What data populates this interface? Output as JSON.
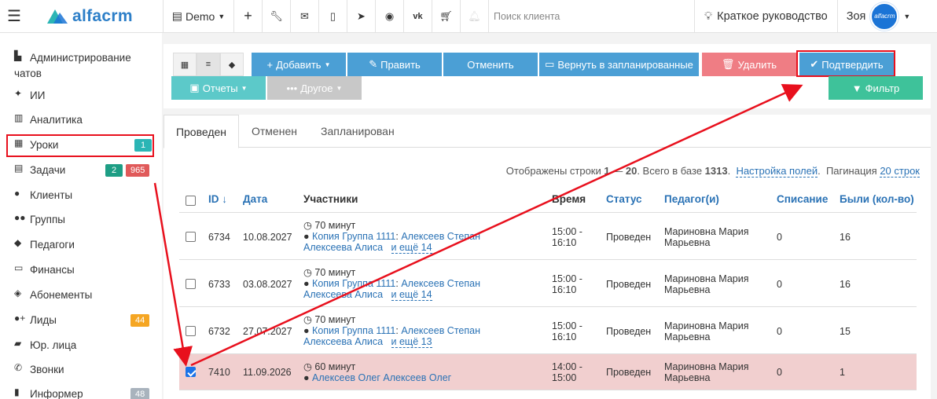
{
  "app": {
    "logo_text": "alfacrm",
    "company": "Demo",
    "search_placeholder": "Поиск клиента",
    "guide_label": "Краткое руководство",
    "user_name": "Зоя",
    "avatar_text": "alfacrm"
  },
  "sidebar": {
    "items": [
      {
        "label": "Администрирование",
        "label2": "чатов",
        "icon": "chat-settings-icon"
      },
      {
        "label": "ИИ",
        "icon": "sparkle-icon"
      },
      {
        "label": "Аналитика",
        "icon": "map-icon"
      },
      {
        "label": "Уроки",
        "icon": "calendar-icon",
        "badge": "1",
        "badge_color": "#2bb5b5"
      },
      {
        "label": "Задачи",
        "icon": "clipboard-icon",
        "badge": "2",
        "badge_color": "#1e9e85",
        "badge2": "965",
        "badge2_color": "#e05a5a"
      },
      {
        "label": "Клиенты",
        "icon": "user-icon"
      },
      {
        "label": "Группы",
        "icon": "users-icon"
      },
      {
        "label": "Педагоги",
        "icon": "graduation-cap-icon"
      },
      {
        "label": "Финансы",
        "icon": "money-icon"
      },
      {
        "label": "Абонементы",
        "icon": "tag-icon"
      },
      {
        "label": "Лиды",
        "icon": "user-plus-icon",
        "badge": "44",
        "badge_color": "#f5a623"
      },
      {
        "label": "Юр. лица",
        "icon": "briefcase-icon"
      },
      {
        "label": "Звонки",
        "icon": "phone-icon"
      },
      {
        "label": "Информер",
        "icon": "book-icon",
        "badge": "48",
        "badge_color": "#a9b3bd"
      }
    ]
  },
  "toolbar": {
    "add": "Добавить",
    "edit": "Править",
    "cancel": "Отменить",
    "return_planned": "Вернуть в запланированные",
    "delete": "Удалить",
    "confirm": "Подтвердить",
    "reports": "Отчеты",
    "other": "Другое",
    "filter": "Фильтр"
  },
  "tabs": [
    "Проведен",
    "Отменен",
    "Запланирован"
  ],
  "info": {
    "shown_prefix": "Отображены строки",
    "range_start": "1",
    "range_sep": " — ",
    "range_end": "20",
    "total_prefix": ". Всего в базе",
    "total": "1313",
    "fields_link": "Настройка полей",
    "pagination_label": "Пагинация",
    "pagination_value": "20 строк"
  },
  "table": {
    "headers": {
      "id": "ID ↓",
      "date": "Дата",
      "participants": "Участники",
      "time": "Время",
      "status": "Статус",
      "teacher": "Педагог(и)",
      "writeoff": "Списание",
      "attended": "Были (кол-во)"
    },
    "rows": [
      {
        "id": "6734",
        "date": "10.08.2027",
        "duration": "70 минут",
        "group": "Копия Группа 1111",
        "participant": "Алексеев Степан",
        "participant2": "Алексеева Алиса",
        "more": "и ещё 14",
        "time1": "15:00 -",
        "time2": "16:10",
        "status": "Проведен",
        "teacher1": "Мариновна Мария",
        "teacher2": "Марьевна",
        "writeoff": "0",
        "attended": "16",
        "checked": false
      },
      {
        "id": "6733",
        "date": "03.08.2027",
        "duration": "70 минут",
        "group": "Копия Группа 1111",
        "participant": "Алексеев Степан",
        "participant2": "Алексеева Алиса",
        "more": "и ещё 14",
        "time1": "15:00 -",
        "time2": "16:10",
        "status": "Проведен",
        "teacher1": "Мариновна Мария",
        "teacher2": "Марьевна",
        "writeoff": "0",
        "attended": "16",
        "checked": false
      },
      {
        "id": "6732",
        "date": "27.07.2027",
        "duration": "70 минут",
        "group": "Копия Группа 1111",
        "participant": "Алексеев Степан",
        "participant2": "Алексеева Алиса",
        "more": "и ещё 13",
        "time1": "15:00 -",
        "time2": "16:10",
        "status": "Проведен",
        "teacher1": "Мариновна Мария",
        "teacher2": "Марьевна",
        "writeoff": "0",
        "attended": "15",
        "checked": false
      },
      {
        "id": "7410",
        "date": "11.09.2026",
        "duration": "60 минут",
        "participant": "Алексеев Олег Алексеев Олег",
        "time1": "14:00 -",
        "time2": "15:00",
        "status": "Проведен",
        "teacher1": "Мариновна Мария",
        "teacher2": "Марьевна",
        "writeoff": "0",
        "attended": "1",
        "checked": true
      }
    ]
  },
  "colors": {
    "primary_blue": "#4b9fd5",
    "danger_red": "#ef7d84",
    "teal": "#5cc9c9",
    "green": "#3ec29a",
    "grey": "#c8c8c8",
    "highlight_red": "#e8101d",
    "selected_row": "#f1cfcf"
  }
}
